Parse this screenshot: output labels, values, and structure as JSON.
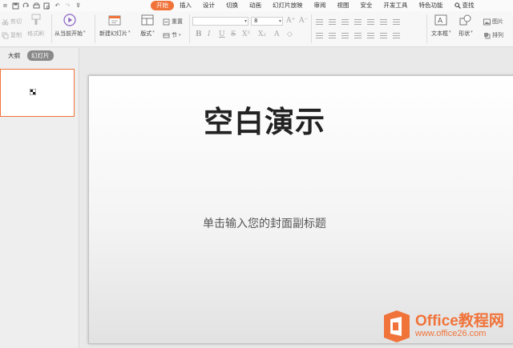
{
  "quick_access": {
    "icons": [
      "save-icon",
      "redo-icon",
      "print-icon",
      "preview-icon",
      "undo-icon",
      "more-icon"
    ]
  },
  "tabs": [
    {
      "label": "开始",
      "active": true
    },
    {
      "label": "插入"
    },
    {
      "label": "设计"
    },
    {
      "label": "切换"
    },
    {
      "label": "动画"
    },
    {
      "label": "幻灯片放映"
    },
    {
      "label": "审阅"
    },
    {
      "label": "视图"
    },
    {
      "label": "安全"
    },
    {
      "label": "开发工具"
    },
    {
      "label": "特色功能"
    },
    {
      "label": "查找"
    }
  ],
  "ribbon": {
    "cut": "剪切",
    "copy": "复制",
    "format_painter": "格式刷",
    "play_from_current": "从当前开始",
    "new_slide": "新建幻灯片",
    "layout": "版式",
    "reset": "重置",
    "section": "节",
    "font_name": "",
    "font_size": "8",
    "text_box": "文本框",
    "shape": "形状",
    "picture": "图片",
    "arrange": "排列"
  },
  "left_pane": {
    "tab_outline": "大纲",
    "tab_slides": "幻灯片"
  },
  "slide": {
    "title": "空白演示",
    "subtitle": "单击输入您的封面副标题"
  },
  "watermark": {
    "name": "Office教程网",
    "url": "www.office26.com"
  },
  "colors": {
    "accent": "#f0733a",
    "ribbon_bg": "#f7f7f7",
    "workspace_bg": "#e9e9e9"
  }
}
